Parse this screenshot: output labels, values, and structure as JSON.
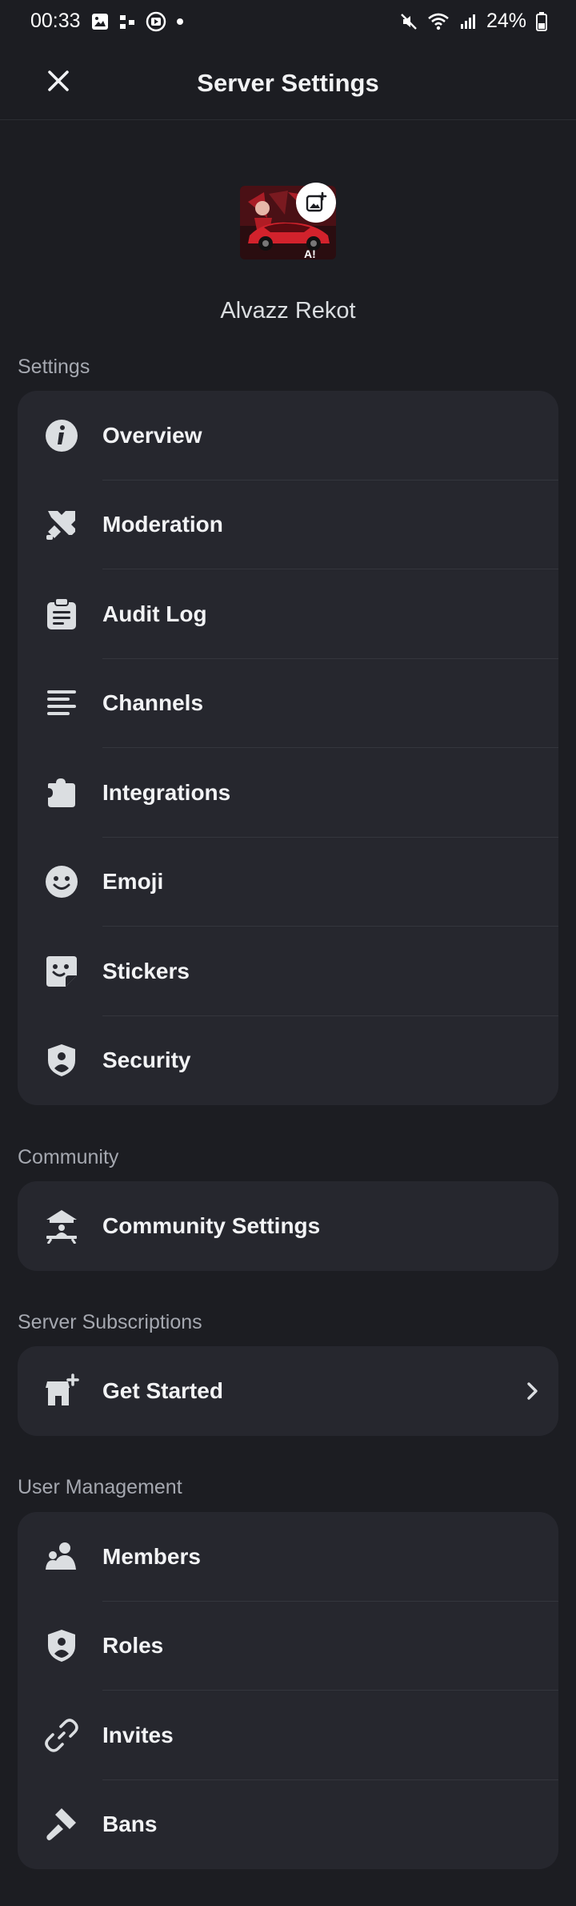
{
  "status_bar": {
    "time": "00:33",
    "battery": "24%"
  },
  "appbar": {
    "title": "Server Settings"
  },
  "server": {
    "name": "Alvazz Rekot"
  },
  "sections": {
    "settings": {
      "label": "Settings"
    },
    "community": {
      "label": "Community"
    },
    "subscriptions": {
      "label": "Server Subscriptions"
    },
    "user_management": {
      "label": "User Management"
    }
  },
  "settings_items": [
    {
      "label": "Overview",
      "icon": "info-icon"
    },
    {
      "label": "Moderation",
      "icon": "swords-icon"
    },
    {
      "label": "Audit Log",
      "icon": "clipboard-icon"
    },
    {
      "label": "Channels",
      "icon": "list-icon"
    },
    {
      "label": "Integrations",
      "icon": "puzzle-icon"
    },
    {
      "label": "Emoji",
      "icon": "smile-icon"
    },
    {
      "label": "Stickers",
      "icon": "sticker-icon"
    },
    {
      "label": "Security",
      "icon": "shield-user-icon"
    }
  ],
  "community_items": [
    {
      "label": "Community Settings",
      "icon": "community-icon"
    }
  ],
  "subscription_items": [
    {
      "label": "Get Started",
      "icon": "shop-icon"
    }
  ],
  "user_items": [
    {
      "label": "Members",
      "icon": "members-icon"
    },
    {
      "label": "Roles",
      "icon": "shield-user-icon"
    },
    {
      "label": "Invites",
      "icon": "link-icon"
    },
    {
      "label": "Bans",
      "icon": "hammer-icon"
    }
  ],
  "colors": {
    "background": "#1c1d22",
    "card": "#26272e",
    "icon": "#dbdee1"
  }
}
